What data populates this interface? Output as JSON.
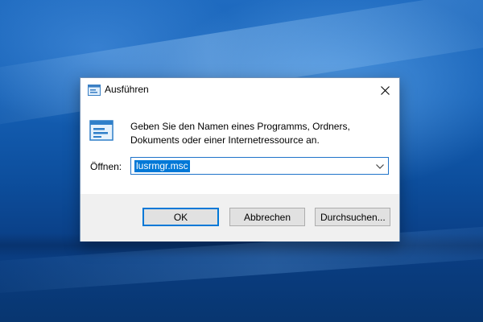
{
  "window": {
    "title": "Ausführen",
    "icon": "run-dialog-icon",
    "close_icon": "close-icon"
  },
  "content": {
    "description_line1": "Geben Sie den Namen eines Programms, Ordners,",
    "description_line2": "Dokuments oder einer Internetressource an.",
    "open_label": "Öffnen:",
    "open_value": "lusrmgr.msc"
  },
  "buttons": {
    "ok": "OK",
    "cancel": "Abbrechen",
    "browse": "Durchsuchen..."
  },
  "colors": {
    "accent": "#0078d7",
    "selection_text": "#ffffff",
    "footer_bg": "#f0f0f0",
    "button_bg": "#e1e1e1"
  }
}
